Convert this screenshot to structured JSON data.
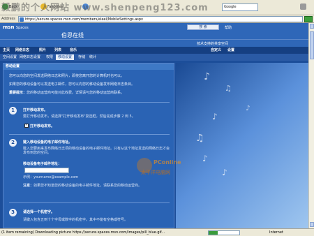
{
  "browser": {
    "toolbar": {
      "back": "Back",
      "favorites": "Favorites",
      "search_box": "Google",
      "overlay_text": "毅鹏的个人网站 www.shenpeng123.com"
    },
    "address": {
      "label": "Address",
      "url": "https://secure.spaces.msn.com/members/eleel/MobileSettings.aspx",
      "go": "Go"
    },
    "status": {
      "text": "(1 item remaining) Downloading picture https://secure.spaces.msn.com/images/pill_blue.gif...",
      "zone": "Internet",
      "progress": 0.3
    }
  },
  "site": {
    "brand": "msn",
    "brand_sub": "Spaces",
    "space_name": "伯恩在线",
    "blog_search": "搜 索",
    "help": "帮助",
    "powered_by": "技术支持的共享空间",
    "nav": [
      "主页",
      "网络日志",
      "照片",
      "列表",
      "音乐"
    ],
    "nav_right": [
      "自定义",
      "设置"
    ],
    "subnav": [
      "空间设置",
      "网络日志设置",
      "权限",
      "移动设置",
      "存储",
      "统计"
    ],
    "subnav_active": 3
  },
  "panel": {
    "title": "移动设置",
    "intro1": "您可以向您的空间发送网络日志和照片，即使您离开您的计算机时也可以。",
    "intro2": "如果您的移动设备可以发送电子邮件，您可以向您的移动设备发布网络日志条目。",
    "notice_bold": "重要提示：",
    "notice": "您的移动运营商可能对此收费。详情请与您的移动运营商联系。",
    "step1": {
      "num": "1",
      "title": "打开移动发布。",
      "desc": "要打开移动发布，请选择\"打开移动发布\"复选框，然后完成步骤 2 到 5。",
      "check_label": "打开移动发布。"
    },
    "step2": {
      "num": "2",
      "title": "键入移动设备的电子邮件地址。",
      "desc": "键入您要用来发布网络日志项的移动设备的电子邮件地址。只有从这个地址发送的网络日志才会发布到您的空间。",
      "field_label": "移动设备电子邮件地址：",
      "example": "示例：yourname@example.com",
      "note_bold": "注意：",
      "note": "如果您不知道您的移动设备的电子邮件地址，请联系您的移动运营商。"
    },
    "step3": {
      "num": "3",
      "title": "请选择一个机密字。",
      "desc": "请键入包含五到十个字母或数字的机密字。其中不能有空格或符号。"
    }
  },
  "watermark": {
    "line1": "PConline",
    "line2": "太平洋电脑网"
  }
}
